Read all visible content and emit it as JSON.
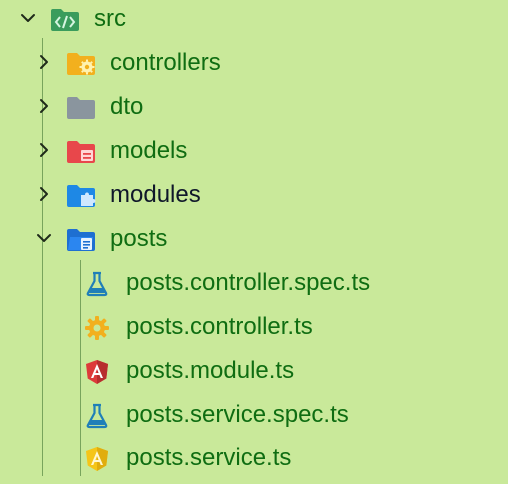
{
  "colors": {
    "background": "#c9e99a",
    "label_green": "#0f6d12",
    "label_dark": "#0f172a",
    "guide": "#6f9c55"
  },
  "tree": {
    "root": {
      "label": "src",
      "icon": "src-folder-icon",
      "expanded": true
    },
    "folders": [
      {
        "label": "controllers",
        "icon": "controllers-folder-icon",
        "expanded": false
      },
      {
        "label": "dto",
        "icon": "dto-folder-icon",
        "expanded": false
      },
      {
        "label": "models",
        "icon": "models-folder-icon",
        "expanded": false
      },
      {
        "label": "modules",
        "icon": "modules-folder-icon",
        "expanded": false
      },
      {
        "label": "posts",
        "icon": "posts-folder-icon",
        "expanded": true
      }
    ],
    "posts_files": [
      {
        "label": "posts.controller.spec.ts",
        "icon": "test-flask-icon"
      },
      {
        "label": "posts.controller.ts",
        "icon": "controller-gear-icon"
      },
      {
        "label": "posts.module.ts",
        "icon": "angular-module-icon"
      },
      {
        "label": "posts.service.spec.ts",
        "icon": "test-flask-icon"
      },
      {
        "label": "posts.service.ts",
        "icon": "angular-service-icon"
      }
    ]
  }
}
